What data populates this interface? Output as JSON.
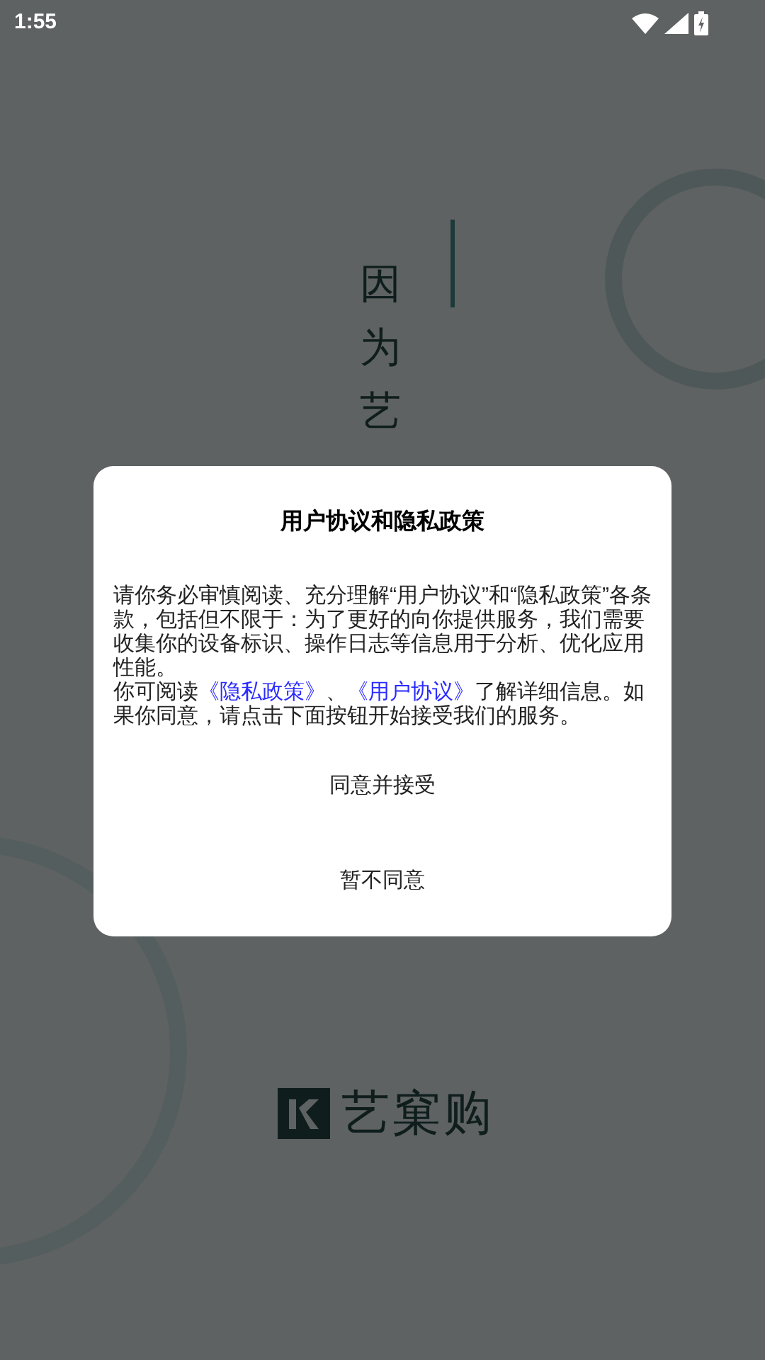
{
  "status_bar": {
    "time": "1:55"
  },
  "splash": {
    "slogan": "因为艺",
    "brand": "艺窠购"
  },
  "dialog": {
    "title": "用户协议和隐私政策",
    "paragraphs": [
      [
        {
          "text": "请你务必审慎阅读、充分理解“用户协议”和“隐私政策”各条款，包括但不限于：为了更好的向你提供服务，我们需要收集你的设备标识、操作日志等信息用于分析、优化应用性能。",
          "kind": "plain"
        }
      ],
      [
        {
          "text": "你可阅读",
          "kind": "plain"
        },
        {
          "text": "《隐私政策》",
          "kind": "link"
        },
        {
          "text": "、",
          "kind": "plain"
        },
        {
          "text": "《用户协议》",
          "kind": "link"
        },
        {
          "text": "了解详细信息。如果你同意，请点击下面按钮开始接受我们的服务。",
          "kind": "plain"
        }
      ]
    ],
    "buttons": [
      "同意并接受",
      "暂不同意"
    ]
  }
}
